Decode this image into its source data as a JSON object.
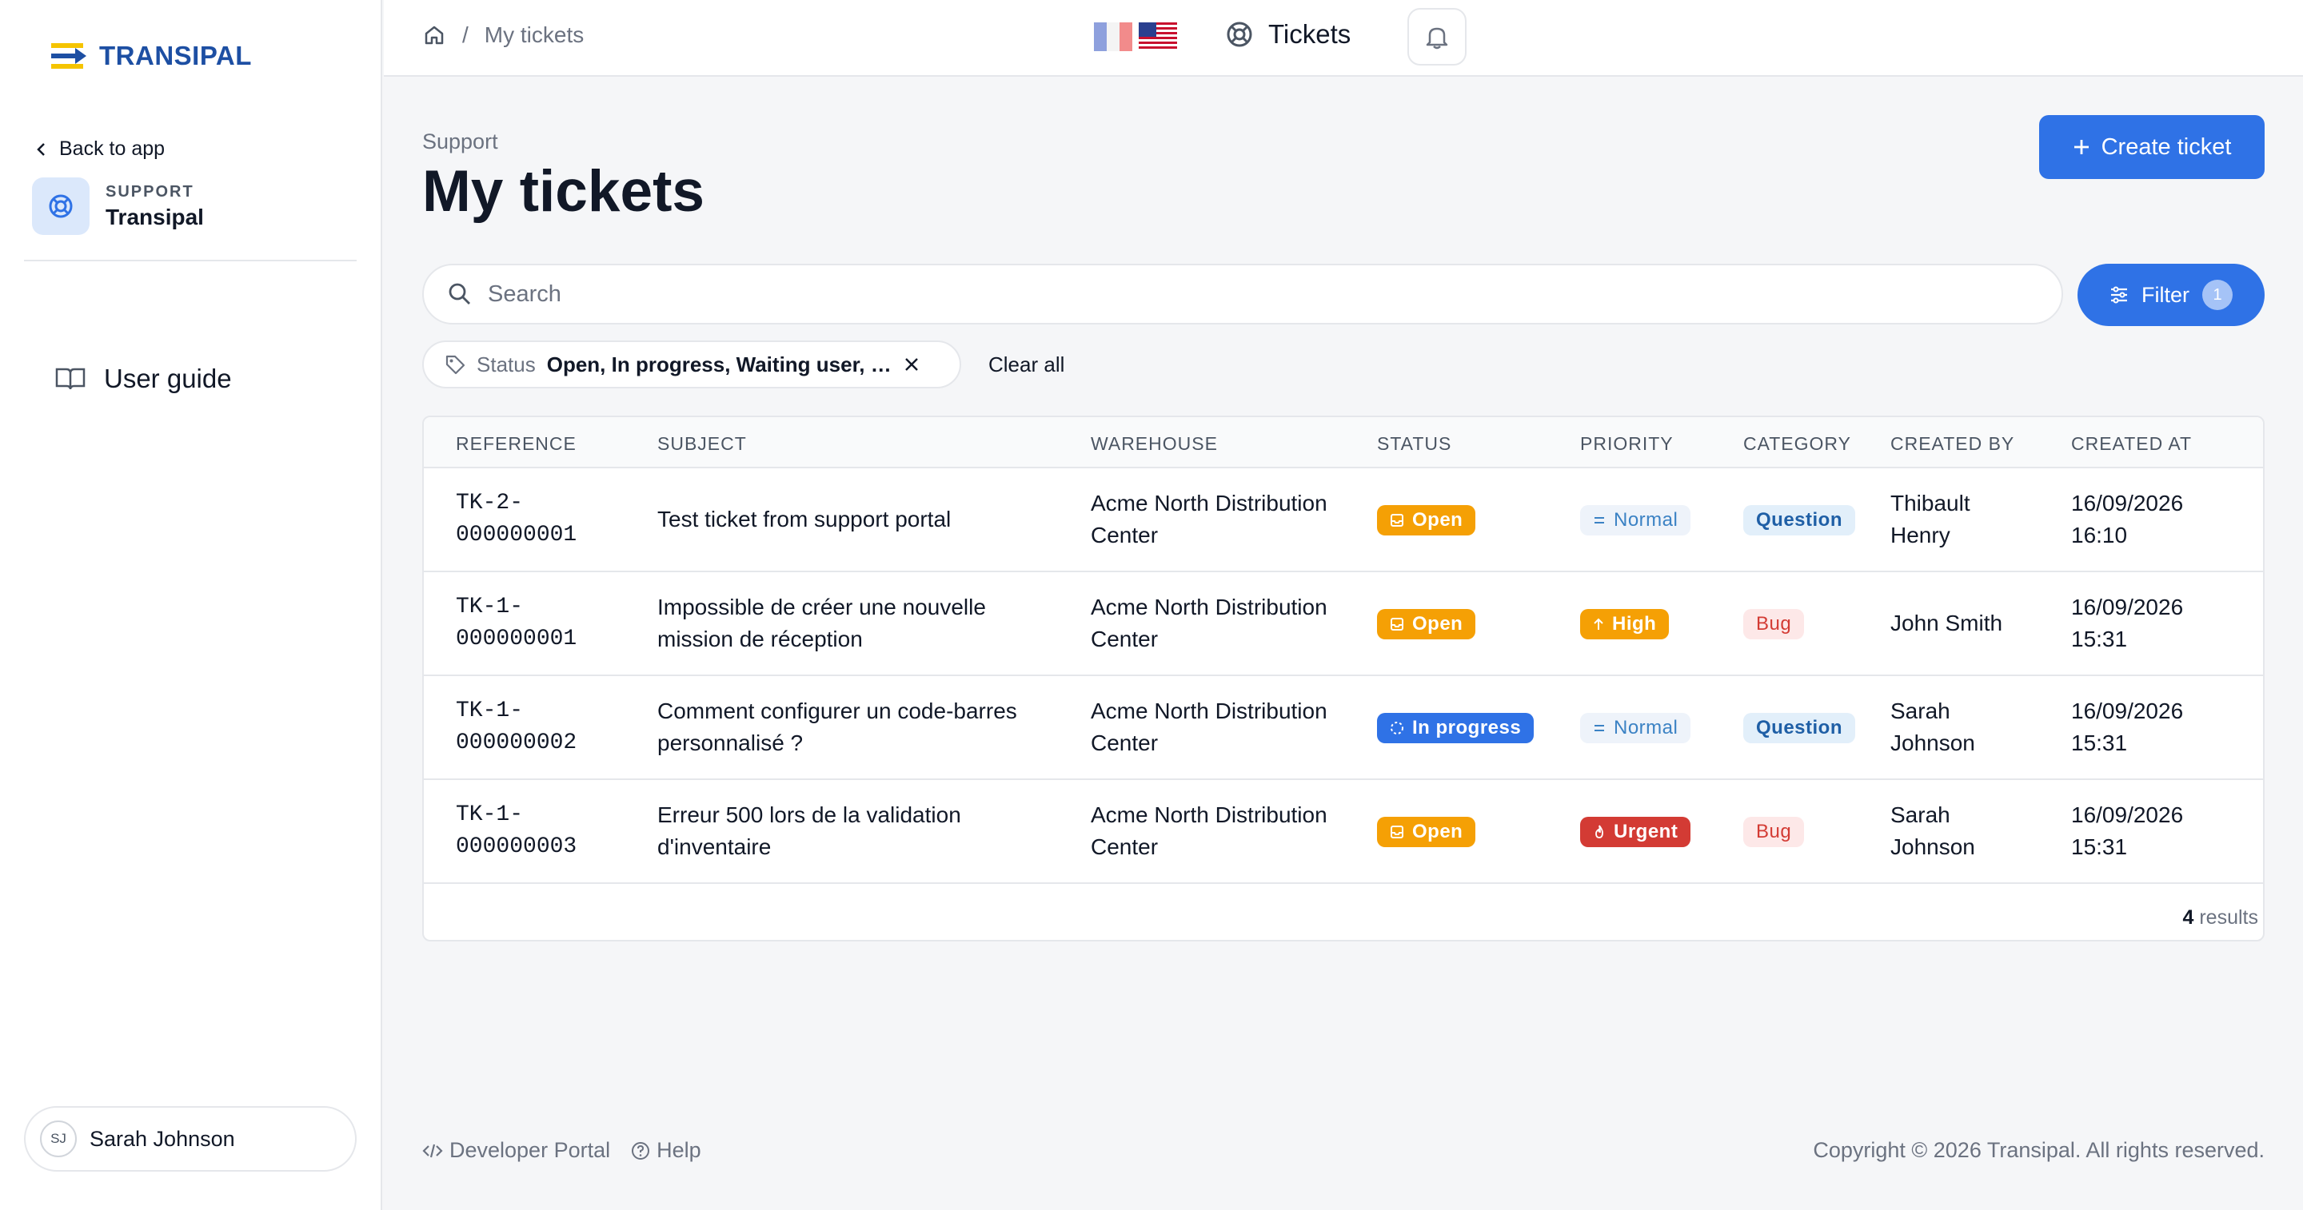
{
  "sidebar": {
    "logo_text": "TRANSIPAL",
    "back_label": "Back to app",
    "app_sub": "SUPPORT",
    "app_name": "Transipal",
    "guide_label": "User guide",
    "user_initials": "SJ",
    "user_name": "Sarah Johnson"
  },
  "topbar": {
    "breadcrumb_current": "My tickets",
    "breadcrumb_sep": "/",
    "tickets_label": "Tickets"
  },
  "page": {
    "overline": "Support",
    "title": "My tickets",
    "create_label": "Create ticket",
    "search_placeholder": "Search",
    "filter_label": "Filter",
    "filter_count": "1",
    "chip_label": "Status",
    "chip_value": "Open, In progress, Waiting user, R...",
    "clear_label": "Clear all"
  },
  "table": {
    "headers": [
      "REFERENCE",
      "SUBJECT",
      "WAREHOUSE",
      "STATUS",
      "PRIORITY",
      "CATEGORY",
      "CREATED BY",
      "CREATED AT"
    ],
    "rows": [
      {
        "ref1": "TK-2-",
        "ref2": "000000001",
        "subject1": "Test ticket from support portal",
        "subject2": "",
        "wh1": "Acme North Distribution",
        "wh2": "Center",
        "status": "Open",
        "priority": "Normal",
        "category": "Question",
        "by1": "Thibault",
        "by2": "Henry",
        "at1": "16/09/2026",
        "at2": "16:10"
      },
      {
        "ref1": "TK-1-",
        "ref2": "000000001",
        "subject1": "Impossible de créer une nouvelle",
        "subject2": "mission de réception",
        "wh1": "Acme North Distribution",
        "wh2": "Center",
        "status": "Open",
        "priority": "High",
        "category": "Bug",
        "by1": "John Smith",
        "by2": "",
        "at1": "16/09/2026",
        "at2": "15:31"
      },
      {
        "ref1": "TK-1-",
        "ref2": "000000002",
        "subject1": "Comment configurer un code-barres",
        "subject2": "personnalisé ?",
        "wh1": "Acme North Distribution",
        "wh2": "Center",
        "status": "In progress",
        "priority": "Normal",
        "category": "Question",
        "by1": "Sarah",
        "by2": "Johnson",
        "at1": "16/09/2026",
        "at2": "15:31"
      },
      {
        "ref1": "TK-1-",
        "ref2": "000000003",
        "subject1": "Erreur 500 lors de la validation",
        "subject2": "d'inventaire",
        "wh1": "Acme North Distribution",
        "wh2": "Center",
        "status": "Open",
        "priority": "Urgent",
        "category": "Bug",
        "by1": "Sarah",
        "by2": "Johnson",
        "at1": "16/09/2026",
        "at2": "15:31"
      }
    ],
    "results_count": "4",
    "results_label": "results"
  },
  "footer": {
    "dev_portal": "Developer Portal",
    "help": "Help",
    "copyright": "Copyright © 2026 Transipal. All rights reserved."
  },
  "colors": {
    "primary": "#2f72e6",
    "open": "#f5a005",
    "urgent": "#d33b34",
    "brand": "#1d4fa3"
  }
}
